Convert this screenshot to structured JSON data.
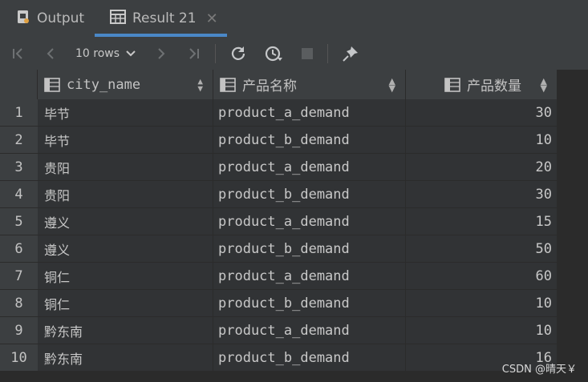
{
  "tabs": [
    {
      "label": "Output",
      "icon": "output-icon",
      "active": false
    },
    {
      "label": "Result 21",
      "icon": "table-icon",
      "active": true,
      "close": "✕"
    }
  ],
  "toolbar": {
    "rows_label": "10 rows",
    "buttons": [
      "first-page-icon",
      "prev-page-icon",
      "next-page-icon",
      "last-page-icon",
      "refresh-icon",
      "history-icon",
      "stop-icon",
      "pin-icon"
    ]
  },
  "table": {
    "columns": [
      "city_name",
      "产品名称",
      "产品数量"
    ],
    "rows": [
      {
        "n": "1",
        "city": "毕节",
        "product": "product_a_demand",
        "qty": "30"
      },
      {
        "n": "2",
        "city": "毕节",
        "product": "product_b_demand",
        "qty": "10"
      },
      {
        "n": "3",
        "city": "贵阳",
        "product": "product_a_demand",
        "qty": "20"
      },
      {
        "n": "4",
        "city": "贵阳",
        "product": "product_b_demand",
        "qty": "30"
      },
      {
        "n": "5",
        "city": "遵义",
        "product": "product_a_demand",
        "qty": "15"
      },
      {
        "n": "6",
        "city": "遵义",
        "product": "product_b_demand",
        "qty": "50"
      },
      {
        "n": "7",
        "city": "铜仁",
        "product": "product_a_demand",
        "qty": "60"
      },
      {
        "n": "8",
        "city": "铜仁",
        "product": "product_b_demand",
        "qty": "10"
      },
      {
        "n": "9",
        "city": "黔东南",
        "product": "product_a_demand",
        "qty": "10"
      },
      {
        "n": "10",
        "city": "黔东南",
        "product": "product_b_demand",
        "qty": "16"
      }
    ]
  },
  "watermark": "CSDN @晴天￥",
  "colors": {
    "accent": "#4a88c7",
    "background": "#2b2b2b",
    "panel": "#3c3f41"
  }
}
